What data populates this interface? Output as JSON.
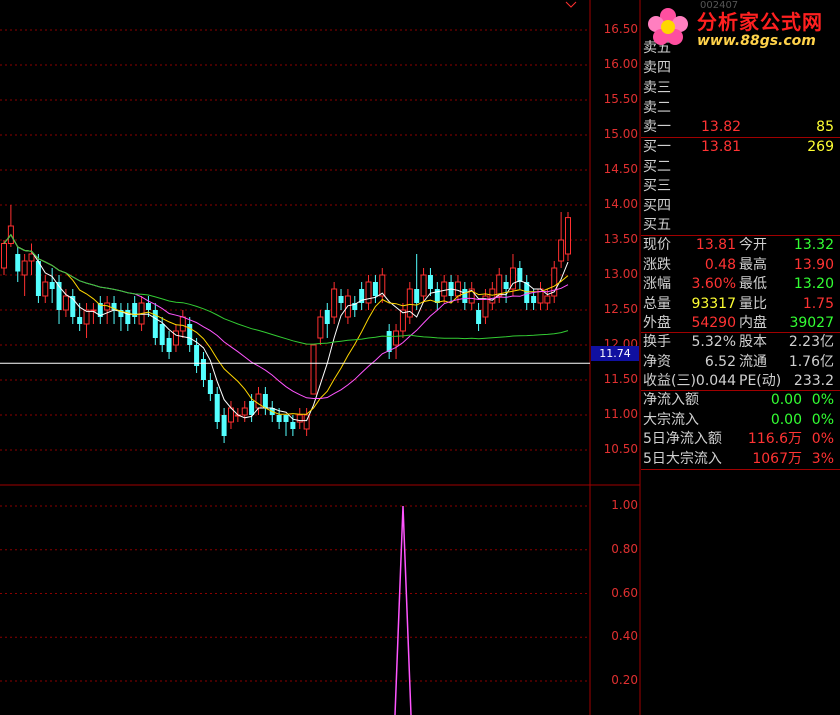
{
  "chart_data": [
    {
      "type": "candlestick",
      "title": "",
      "y_ticks": [
        "16.50",
        "16.00",
        "15.50",
        "15.00",
        "14.50",
        "14.00",
        "13.50",
        "13.00",
        "12.50",
        "12.00",
        "11.50",
        "11.00",
        "10.50"
      ],
      "ylim": [
        10.3,
        16.7
      ],
      "cursor_price": "11.74",
      "candles": [
        [
          13.1,
          13.45,
          13.0,
          13.5
        ],
        [
          13.45,
          13.7,
          13.4,
          14.0
        ],
        [
          13.3,
          13.05,
          12.9,
          13.4
        ],
        [
          13.0,
          13.2,
          12.7,
          13.3
        ],
        [
          13.2,
          13.3,
          13.0,
          13.45
        ],
        [
          13.2,
          12.7,
          12.6,
          13.3
        ],
        [
          12.7,
          12.9,
          12.6,
          13.0
        ],
        [
          12.9,
          12.8,
          12.6,
          13.1
        ],
        [
          12.9,
          12.5,
          12.3,
          13.0
        ],
        [
          12.5,
          12.7,
          12.4,
          12.8
        ],
        [
          12.7,
          12.4,
          12.3,
          12.8
        ],
        [
          12.4,
          12.3,
          12.2,
          12.6
        ],
        [
          12.3,
          12.5,
          12.1,
          12.6
        ],
        [
          12.5,
          12.5,
          12.3,
          12.6
        ],
        [
          12.6,
          12.4,
          12.3,
          12.7
        ],
        [
          12.5,
          12.6,
          12.3,
          12.7
        ],
        [
          12.6,
          12.5,
          12.3,
          12.7
        ],
        [
          12.5,
          12.4,
          12.2,
          12.6
        ],
        [
          12.5,
          12.3,
          12.2,
          12.6
        ],
        [
          12.6,
          12.4,
          12.3,
          12.7
        ],
        [
          12.3,
          12.6,
          12.2,
          12.7
        ],
        [
          12.6,
          12.5,
          12.4,
          12.7
        ],
        [
          12.5,
          12.1,
          12.0,
          12.6
        ],
        [
          12.3,
          12.0,
          11.9,
          12.4
        ],
        [
          12.1,
          11.9,
          11.8,
          12.2
        ],
        [
          12.0,
          12.2,
          11.9,
          12.3
        ],
        [
          12.2,
          12.4,
          12.1,
          12.5
        ],
        [
          12.3,
          12.0,
          11.9,
          12.4
        ],
        [
          12.0,
          11.7,
          11.6,
          12.1
        ],
        [
          11.8,
          11.5,
          11.4,
          11.9
        ],
        [
          11.5,
          11.3,
          11.2,
          11.6
        ],
        [
          11.3,
          10.9,
          10.8,
          11.4
        ],
        [
          11.0,
          10.7,
          10.6,
          11.1
        ],
        [
          10.9,
          11.1,
          10.8,
          11.2
        ],
        [
          11.0,
          11.0,
          10.9,
          11.1
        ],
        [
          11.0,
          11.1,
          10.9,
          11.2
        ],
        [
          11.2,
          11.0,
          10.9,
          11.3
        ],
        [
          11.1,
          11.3,
          11.0,
          11.4
        ],
        [
          11.3,
          11.1,
          11.0,
          11.4
        ],
        [
          11.1,
          11.0,
          10.9,
          11.2
        ],
        [
          11.0,
          10.9,
          10.8,
          11.1
        ],
        [
          11.0,
          10.9,
          10.7,
          11.0
        ],
        [
          10.9,
          10.8,
          10.7,
          11.0
        ],
        [
          10.9,
          11.0,
          10.8,
          11.1
        ],
        [
          10.8,
          11.0,
          10.7,
          11.1
        ],
        [
          11.3,
          12.0,
          11.3,
          12.0
        ],
        [
          12.1,
          12.4,
          12.0,
          12.5
        ],
        [
          12.5,
          12.3,
          12.1,
          12.6
        ],
        [
          12.4,
          12.8,
          12.3,
          12.9
        ],
        [
          12.7,
          12.6,
          12.5,
          12.8
        ],
        [
          12.4,
          12.7,
          12.3,
          12.8
        ],
        [
          12.6,
          12.5,
          12.4,
          12.7
        ],
        [
          12.8,
          12.6,
          12.5,
          12.9
        ],
        [
          12.6,
          12.9,
          12.5,
          13.0
        ],
        [
          12.9,
          12.7,
          12.6,
          13.0
        ],
        [
          12.7,
          13.0,
          12.6,
          13.1
        ],
        [
          12.2,
          11.9,
          11.8,
          12.3
        ],
        [
          12.0,
          12.2,
          11.8,
          12.3
        ],
        [
          12.2,
          12.5,
          12.1,
          12.6
        ],
        [
          12.4,
          12.8,
          12.3,
          12.9
        ],
        [
          12.8,
          12.6,
          12.5,
          13.3
        ],
        [
          12.7,
          13.0,
          12.6,
          13.1
        ],
        [
          13.0,
          12.8,
          12.7,
          13.1
        ],
        [
          12.8,
          12.6,
          12.5,
          12.9
        ],
        [
          12.7,
          12.9,
          12.6,
          13.0
        ],
        [
          12.9,
          12.7,
          12.6,
          13.0
        ],
        [
          12.7,
          12.9,
          12.6,
          13.0
        ],
        [
          12.8,
          12.6,
          12.5,
          12.9
        ],
        [
          12.6,
          12.8,
          12.5,
          12.9
        ],
        [
          12.5,
          12.3,
          12.2,
          12.6
        ],
        [
          12.4,
          12.7,
          12.3,
          12.8
        ],
        [
          12.6,
          12.8,
          12.5,
          12.9
        ],
        [
          12.7,
          13.0,
          12.6,
          13.1
        ],
        [
          12.9,
          12.8,
          12.6,
          13.0
        ],
        [
          12.8,
          13.1,
          12.7,
          13.3
        ],
        [
          13.1,
          12.9,
          12.8,
          13.2
        ],
        [
          12.9,
          12.6,
          12.5,
          13.0
        ],
        [
          12.7,
          12.6,
          12.5,
          12.8
        ],
        [
          12.6,
          12.8,
          12.5,
          12.9
        ],
        [
          12.6,
          12.7,
          12.5,
          12.8
        ],
        [
          12.7,
          13.1,
          12.6,
          13.2
        ],
        [
          13.2,
          13.5,
          13.1,
          13.9
        ],
        [
          13.3,
          13.82,
          13.2,
          13.9
        ]
      ],
      "ma_colors": {
        "ma5": "#ffffff",
        "ma10": "#ffd700",
        "ma20": "#ff55ff",
        "ma60": "#33cc33"
      }
    },
    {
      "type": "line",
      "y_ticks": [
        "1.00",
        "0.80",
        "0.60",
        "0.40",
        "0.20"
      ],
      "ylim": [
        0,
        1.0
      ],
      "spike_index": 45,
      "color": "#ff55ff"
    }
  ],
  "colors": {
    "up": "#ff3030",
    "down": "#54ffff",
    "grid": "#8b0000",
    "axis": "#a00000"
  },
  "logo": {
    "title": "分析家公式网",
    "url": "www.88gs.com"
  },
  "stock_code": "002407",
  "orderbook": {
    "sell": [
      {
        "label": "卖五",
        "price": "",
        "vol": ""
      },
      {
        "label": "卖四",
        "price": "",
        "vol": ""
      },
      {
        "label": "卖三",
        "price": "",
        "vol": ""
      },
      {
        "label": "卖二",
        "price": "",
        "vol": ""
      },
      {
        "label": "卖一",
        "price": "13.82",
        "vol": "85"
      }
    ],
    "buy": [
      {
        "label": "买一",
        "price": "13.81",
        "vol": "269"
      },
      {
        "label": "买二",
        "price": "",
        "vol": ""
      },
      {
        "label": "买三",
        "price": "",
        "vol": ""
      },
      {
        "label": "买四",
        "price": "",
        "vol": ""
      },
      {
        "label": "买五",
        "price": "",
        "vol": ""
      }
    ]
  },
  "quote": [
    {
      "l1": "现价",
      "v1": "13.81",
      "c1": "#ff3333",
      "l2": "今开",
      "v2": "13.32",
      "c2": "#33ff33"
    },
    {
      "l1": "涨跌",
      "v1": "0.48",
      "c1": "#ff3333",
      "l2": "最高",
      "v2": "13.90",
      "c2": "#ff3333"
    },
    {
      "l1": "涨幅",
      "v1": "3.60%",
      "c1": "#ff3333",
      "l2": "最低",
      "v2": "13.20",
      "c2": "#33ff33"
    },
    {
      "l1": "总量",
      "v1": "93317",
      "c1": "#ffff33",
      "l2": "量比",
      "v2": "1.75",
      "c2": "#ff3333"
    },
    {
      "l1": "外盘",
      "v1": "54290",
      "c1": "#ff3333",
      "l2": "内盘",
      "v2": "39027",
      "c2": "#33ff33"
    }
  ],
  "fundamentals": [
    {
      "l1": "换手",
      "v1": "5.32%",
      "l2": "股本",
      "v2": "2.23亿"
    },
    {
      "l1": "净资",
      "v1": "6.52",
      "l2": "流通",
      "v2": "1.76亿"
    },
    {
      "l1": "收益(三)",
      "v1": "0.044",
      "l2": "PE(动)",
      "v2": "233.2"
    }
  ],
  "flows": [
    {
      "label": "净流入额",
      "v1": "0.00",
      "c1": "#33ff33",
      "v2": "0%",
      "c2": "#33ff33"
    },
    {
      "label": "大宗流入",
      "v1": "0.00",
      "c1": "#33ff33",
      "v2": "0%",
      "c2": "#33ff33"
    },
    {
      "label": "5日净流入额",
      "v1": "116.6万",
      "c1": "#ff3333",
      "v2": "0%",
      "c2": "#ff3333"
    },
    {
      "label": "5日大宗流入",
      "v1": "1067万",
      "c1": "#ff3333",
      "v2": "3%",
      "c2": "#ff3333"
    }
  ]
}
